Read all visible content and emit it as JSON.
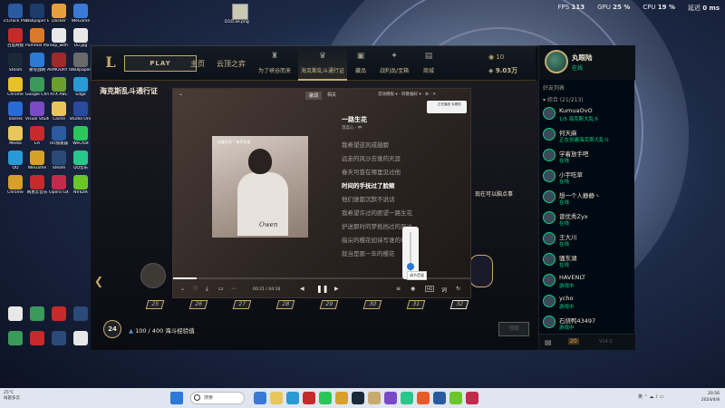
{
  "overlay": {
    "fps_label": "FPS",
    "fps_value": "113",
    "gpu_label": "GPU",
    "gpu_value": "25 %",
    "cpu_label": "CPU",
    "cpu_value": "19 %",
    "lat_label": "延迟",
    "lat_value": "0 ms"
  },
  "desktop": {
    "screenshot_file": "D1D.ae.png",
    "icons": [
      {
        "label": "icLTrack Plus",
        "color": "#2a5aa0"
      },
      {
        "label": "Wallpaper Engine",
        "color": "#1c3c6a"
      },
      {
        "label": "Docker",
        "color": "#e6a03a"
      },
      {
        "label": "WeGame",
        "color": "#3a7ad6"
      },
      {
        "label": "百度网盘",
        "color": "#c62a2a"
      },
      {
        "label": "Pummel Party",
        "color": "#d87a2a"
      },
      {
        "label": "exp_with",
        "color": "#e8e8e8"
      },
      {
        "label": "Uu.jpg",
        "color": "#e8e8e8"
      },
      {
        "label": "Steam",
        "color": "#1b2838"
      },
      {
        "label": "暴雪战网",
        "color": "#2a7ad6"
      },
      {
        "label": "ARMOURY CRATE",
        "color": "#a02a2a"
      },
      {
        "label": "Wallpaper",
        "color": "#6a6a6a"
      },
      {
        "label": "Chrome",
        "color": "#e8c02a"
      },
      {
        "label": "Google Chrome",
        "color": "#3a9a5a"
      },
      {
        "label": "RTX ABC",
        "color": "#6aa02a"
      },
      {
        "label": "Edge",
        "color": "#2a9ad6"
      },
      {
        "label": "ToDesk",
        "color": "#2a6ad6"
      },
      {
        "label": "Visual Studio",
        "color": "#7a4ac6"
      },
      {
        "label": "Cache",
        "color": "#e8c65a"
      },
      {
        "label": "Studio One",
        "color": "#2a4aa0"
      },
      {
        "label": "Media",
        "color": "#e8c65a"
      },
      {
        "label": "EA",
        "color": "#c62a2a"
      },
      {
        "label": "UU加速器",
        "color": "#2a5aa0"
      },
      {
        "label": "WeChat",
        "color": "#2ac65a"
      },
      {
        "label": "QQ",
        "color": "#2a9ad6"
      },
      {
        "label": "WeGame",
        "color": "#d6a02a"
      },
      {
        "label": "Steam",
        "color": "#2a4a7a"
      },
      {
        "label": "QQ音乐",
        "color": "#2ac68a"
      },
      {
        "label": "Chrome",
        "color": "#d6a02a"
      },
      {
        "label": "网易云音乐",
        "color": "#c62a2a"
      },
      {
        "label": "Opera GX",
        "color": "#c62a4a"
      },
      {
        "label": "NVIDIA",
        "color": "#6ac62a"
      }
    ]
  },
  "client": {
    "logo": "L",
    "play_label": "PLAY",
    "tabs": [
      {
        "label": "主页",
        "small": false
      },
      {
        "label": "云顶之弈",
        "small": false
      },
      {
        "label": "为了峡谷而来",
        "small": true,
        "icon": "♜"
      },
      {
        "label": "海克斯乱斗通行证",
        "small": true,
        "icon": "♛"
      },
      {
        "label": "藏品",
        "small": true,
        "icon": "▣"
      },
      {
        "label": "战利品/宝箱",
        "small": true,
        "icon": "✦"
      },
      {
        "label": "商城",
        "small": true,
        "icon": "▤"
      }
    ],
    "rp": "10",
    "be": "9.03万"
  },
  "social": {
    "name": "丸眼陆",
    "status": "在线",
    "header": "好友列表",
    "group": "▾ 综合 (21/213)",
    "friends": [
      {
        "name": "KumuaOvO",
        "status": "1/5 海克斯大乱斗"
      },
      {
        "name": "何天麻",
        "status": "正在创建海克斯大乱斗"
      },
      {
        "name": "学着放手吧",
        "status": "在线"
      },
      {
        "name": "小宇吃草",
        "status": "在线"
      },
      {
        "name": "想一个人静静丶",
        "status": "在线"
      },
      {
        "name": "曾优秀Zyx",
        "status": "在线"
      },
      {
        "name": "王大川",
        "status": "在线"
      },
      {
        "name": "骚东湖",
        "status": "在线"
      },
      {
        "name": "HAVENLT",
        "status": "游戏中"
      },
      {
        "name": "ycho",
        "status": "游戏中"
      },
      {
        "name": "石烧鸭43497",
        "status": "游戏中"
      }
    ],
    "bottom_count": "20",
    "version": "V14.5"
  },
  "pass": {
    "title": "海克斯乱斗通行证",
    "note": "现在可以脑点事",
    "levels": [
      "25",
      "26",
      "27",
      "28",
      "29",
      "30",
      "31",
      "32"
    ],
    "current_level": "24",
    "xp_text": "100 / 400 海斗经验值",
    "claim": "领取"
  },
  "player": {
    "tab_active": "歌词",
    "tab_other": "相关",
    "options": "音效模板 ▾ · 听歌偏好 ▾ · ⚙ · ✕",
    "album_caption": "在路光里 \" 有声年度",
    "album_sign": "Owen",
    "song_title": "一路生花",
    "song_artist": "温奕心 · 中",
    "lyrics": [
      {
        "text": "我希望逆风成翅膀",
        "current": false
      },
      {
        "text": "远走的风沙去谁的天涯",
        "current": false
      },
      {
        "text": "春天可曾在哪里见过他",
        "current": false
      },
      {
        "text": "时间的手抚过了脸颊",
        "current": true
      },
      {
        "text": "他们谁都沉默不说话",
        "current": false
      },
      {
        "text": "我希望许过的愿望一路生花",
        "current": false
      },
      {
        "text": "护送那时的梦抵挡过的风沙",
        "current": false
      },
      {
        "text": "指尖的樱花如诗写谁的年华",
        "current": false
      },
      {
        "text": "就当是那一年的樱花",
        "current": false
      }
    ],
    "time": "00:21 / 04:16",
    "progress": 0.08,
    "play_icon": "❚❚",
    "prev_icon": "◀",
    "next_icon": "▶",
    "volume_tip": "调节音量",
    "mini_card": "正在播放·丸眼陆"
  },
  "taskbar": {
    "weather_line1": "25°C",
    "weather_line2": "局部多云",
    "search": "搜索",
    "tray": "英 ⌃ ☁ ♪ ▭",
    "time": "20:56",
    "date": "2024/4/8"
  },
  "colors": {
    "gold": "#c8aa6e",
    "online": "#0acf83",
    "taskbar": "#dfe6ef"
  }
}
